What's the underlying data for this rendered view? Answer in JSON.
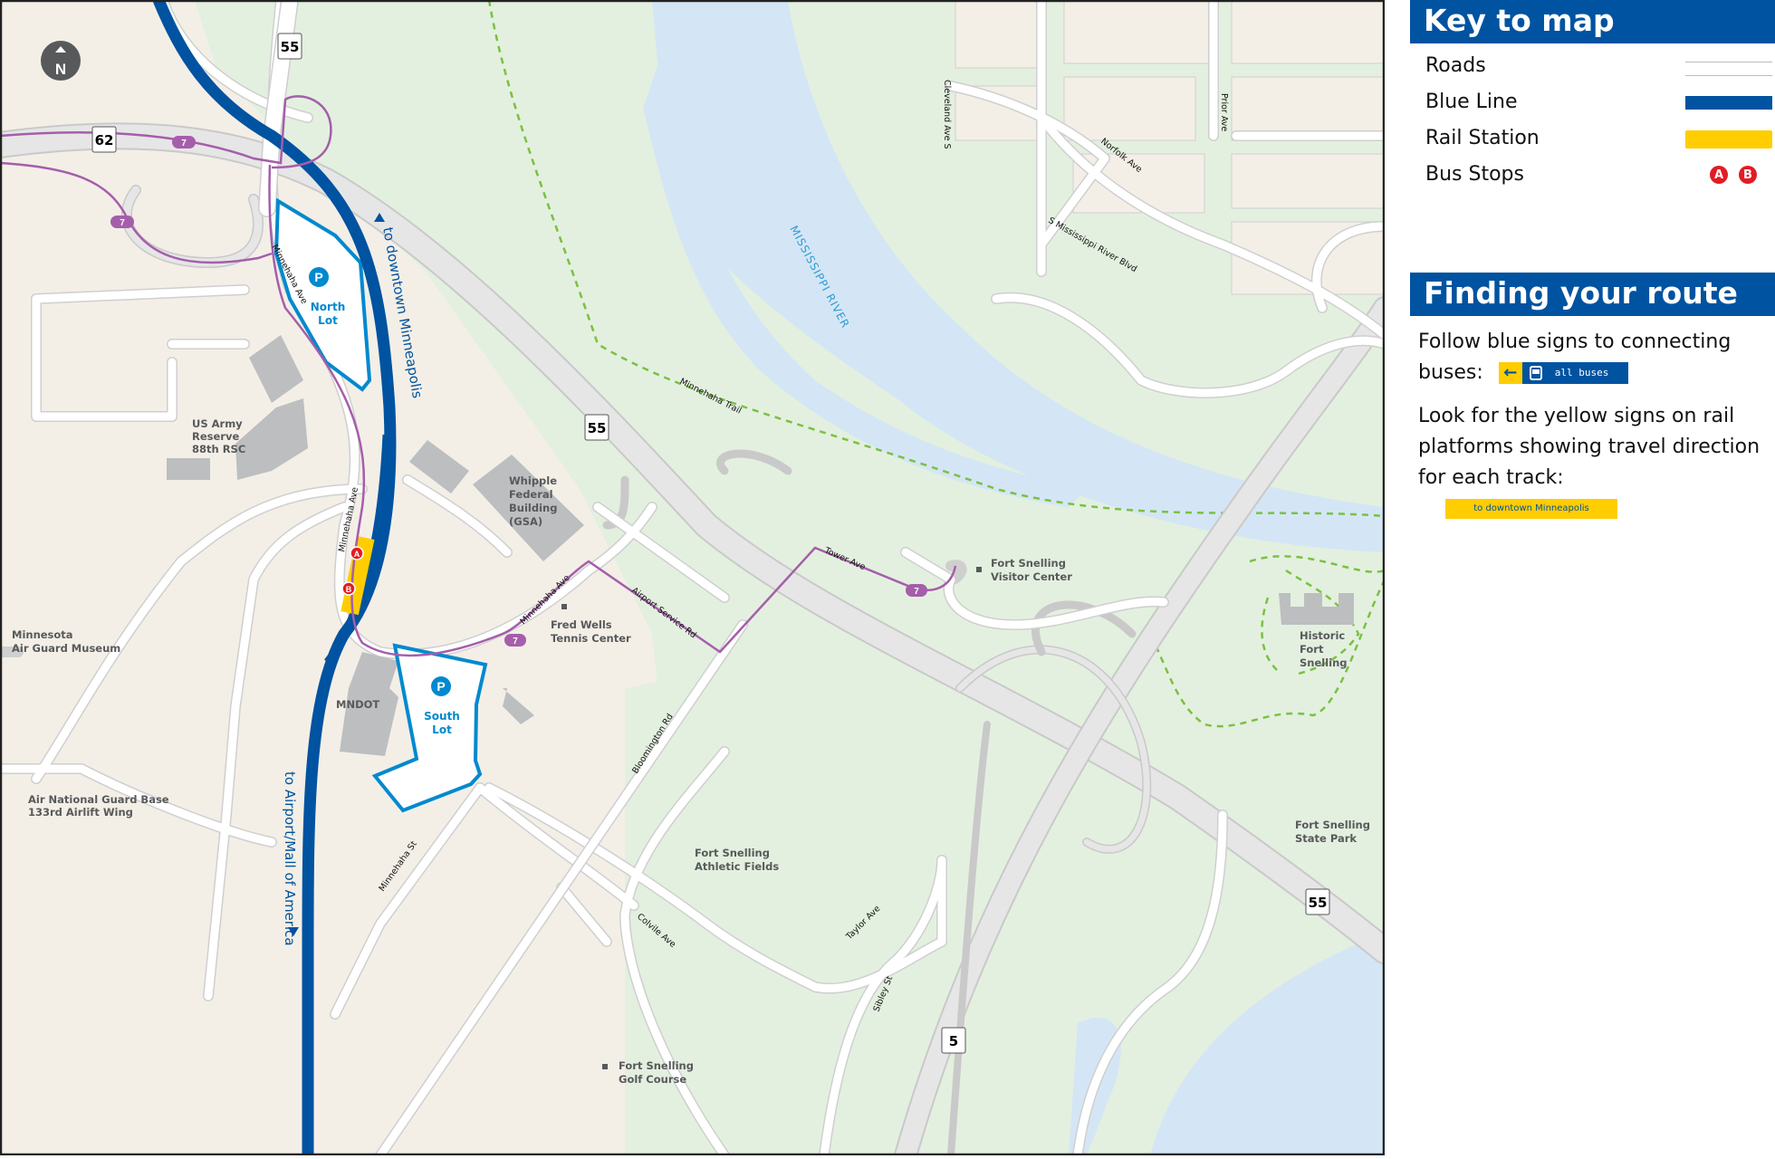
{
  "map": {
    "north_indicator": "N",
    "highway_shields": {
      "hwy55_top": "55",
      "hwy62": "62",
      "hwy55_mid": "55",
      "hwy55_right": "55",
      "hwy5": "5"
    },
    "bus_route": "7",
    "bus_stops": {
      "a": "A",
      "b": "B"
    },
    "parking": {
      "north_lot": {
        "icon": "P",
        "line1": "North",
        "line2": "Lot"
      },
      "south_lot": {
        "icon": "P",
        "line1": "South",
        "line2": "Lot"
      }
    },
    "directions": {
      "northbound": "to downtown Minneapolis",
      "southbound": "to Airport/Mall of America"
    },
    "water": {
      "river": "MISSISSIPPI RIVER"
    },
    "places": {
      "us_army": [
        "US Army",
        "Reserve",
        "88th RSC"
      ],
      "whipple": [
        "Whipple",
        "Federal",
        "Building",
        "(GSA)"
      ],
      "air_guard_museum": [
        "Minnesota",
        "Air Guard Museum"
      ],
      "air_national_guard": [
        "Air National Guard Base",
        "133rd Airlift Wing"
      ],
      "mndot": "MNDOT",
      "tennis": [
        "Fred Wells",
        "Tennis Center"
      ],
      "visitor_center": [
        "Fort Snelling",
        "Visitor Center"
      ],
      "historic_fort": [
        "Historic",
        "Fort",
        "Snelling"
      ],
      "athletic_fields": [
        "Fort Snelling",
        "Athletic Fields"
      ],
      "state_park": [
        "Fort Snelling",
        "State Park"
      ],
      "golf_course": [
        "Fort Snelling",
        "Golf Course"
      ]
    },
    "streets": {
      "minnehaha_ave_north": "Minnehaha Ave",
      "minnehaha_ave_station": "Minnehaha Ave",
      "minnehaha_ave_east": "Minnehaha Ave",
      "airport_service_rd": "Airport Service Rd",
      "tower_ave": "Tower Ave",
      "bloomington_rd": "Bloomington Rd",
      "minnehaha_st": "Minnehaha St",
      "colvile_ave": "Colvile Ave",
      "taylor_ave": "Taylor Ave",
      "sibley_st": "Sibley St",
      "cleveland_ave": "Cleveland Ave S",
      "prior_ave": "Prior Ave",
      "norfolk_ave": "Norfolk Ave",
      "river_blvd": "S Mississippi River Blvd",
      "minnehaha_trail": "Minnehaha Trail"
    }
  },
  "key": {
    "title": "Key to map",
    "items": [
      {
        "label": "Roads",
        "swatch": "road"
      },
      {
        "label": "Blue Line",
        "swatch": "blue-line",
        "color": "#0053a0"
      },
      {
        "label": "Rail Station",
        "swatch": "rail-station",
        "color": "#ffcd00"
      },
      {
        "label": "Bus Stops",
        "swatch": "bus-stops",
        "stops": [
          "A",
          "B"
        ],
        "color": "#e31b23"
      }
    ]
  },
  "route": {
    "title": "Finding your route",
    "para1": "Follow blue signs to connecting buses:",
    "para1_line1": "Follow blue signs to connecting",
    "para1_line2": "buses:",
    "bus_sign": {
      "arrow": "←",
      "label": "all buses"
    },
    "para2_line1": "Look for the yellow signs on rail",
    "para2_line2": "platforms showing travel direction",
    "para2_line3": "for each track:",
    "yellow_sign": "to downtown Minneapolis"
  },
  "colors": {
    "brand_blue": "#0053a0",
    "station_yellow": "#ffcd00",
    "bus_route_purple": "#a55eaa",
    "parking_blue": "#0089cf",
    "park_green": "#e3f0df",
    "land": "#f3efe7",
    "water": "#d4e6f5",
    "trail_green": "#7ac143",
    "bus_stop_red": "#e31b23"
  }
}
